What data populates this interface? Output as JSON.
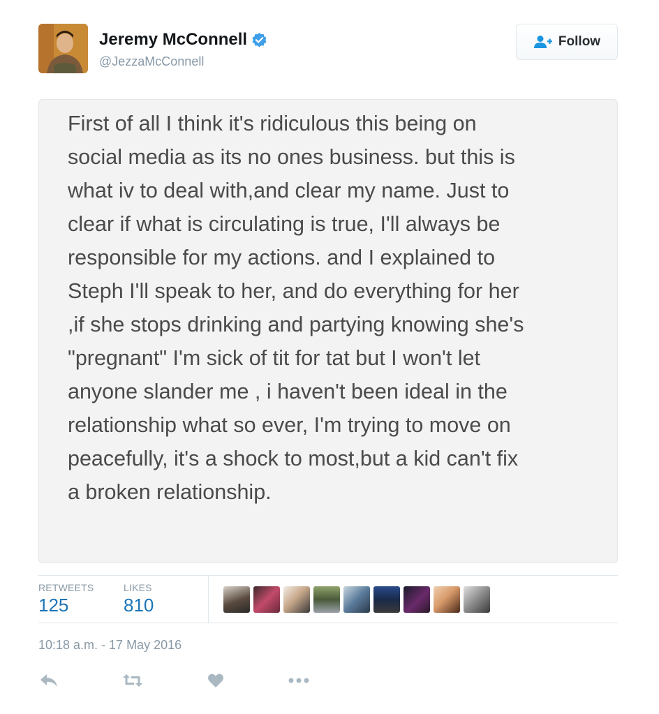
{
  "user": {
    "display_name": "Jeremy McConnell",
    "handle": "@JezzaMcConnell",
    "verified": true
  },
  "follow_button": {
    "label": "Follow",
    "icon": "add-user-icon"
  },
  "tweet": {
    "note_text": "First of all I think it's ridiculous this being on\nsocial media as its no ones business. but this is\nwhat iv to deal with,and clear my name. Just to\nclear if what is circulating is true, I'll always be\nresponsible for my actions. and I explained to\nSteph I'll speak to her, and do everything for her\n,if she stops drinking and partying knowing she's\n\"pregnant\"  I'm sick of tit for tat but I won't let\nanyone slander me , i haven't been ideal in the\nrelationship what so ever, I'm trying to move on\npeacefully, it's a shock to most,but a kid can't fix\na broken relationship.",
    "timestamp": "10:18 a.m. - 17 May 2016"
  },
  "stats": {
    "retweets_label": "RETWEETS",
    "retweets_count": "125",
    "likes_label": "LIKES",
    "likes_count": "810"
  },
  "actions": [
    "reply-icon",
    "retweet-icon",
    "like-icon",
    "more-icon"
  ],
  "colors": {
    "link_blue": "#1b74b6",
    "verified_blue": "#3f9fe8",
    "muted": "#8899a6",
    "note_bg": "#f3f3f3"
  }
}
